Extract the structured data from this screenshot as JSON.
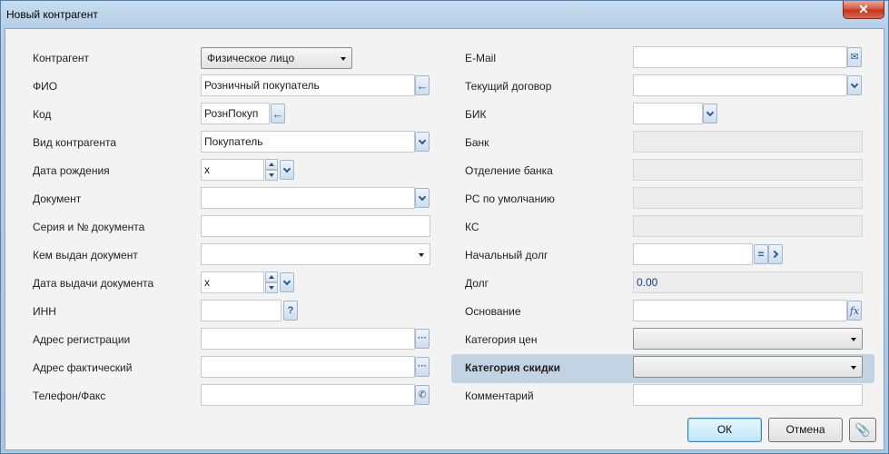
{
  "window": {
    "title": "Новый контрагент",
    "close_label": "✕"
  },
  "left": {
    "counterparty_label": "Контрагент",
    "counterparty_value": "Физическое лицо",
    "fio_label": "ФИО",
    "fio_value": "Розничный покупатель",
    "code_label": "Код",
    "code_value": "РознПокуп",
    "kind_label": "Вид контрагента",
    "kind_value": "Покупатель",
    "birth_label": "Дата рождения",
    "birth_value": "x",
    "doc_label": "Документ",
    "doc_value": "",
    "doc_series_label": "Серия и № документа",
    "doc_series_value": "",
    "issued_by_label": "Кем выдан документ",
    "issued_by_value": "",
    "issue_date_label": "Дата выдачи документа",
    "issue_date_value": "x",
    "inn_label": "ИНН",
    "inn_value": "",
    "reg_addr_label": "Адрес регистрации",
    "reg_addr_value": "",
    "fact_addr_label": "Адрес фактический",
    "fact_addr_value": "",
    "phone_label": "Телефон/Факс",
    "phone_value": ""
  },
  "right": {
    "email_label": "E-Mail",
    "email_value": "",
    "contract_label": "Текущий договор",
    "contract_value": "",
    "bik_label": "БИК",
    "bik_value": "",
    "bank_label": "Банк",
    "bank_value": "",
    "branch_label": "Отделение банка",
    "branch_value": "",
    "account_label": "РС по умолчанию",
    "account_value": "",
    "ks_label": "КС",
    "ks_value": "",
    "init_debt_label": "Начальный долг",
    "init_debt_value": "",
    "debt_label": "Долг",
    "debt_value": "0.00",
    "basis_label": "Основание",
    "basis_value": "",
    "price_cat_label": "Категория цен",
    "price_cat_value": "",
    "discount_cat_label": "Категория скидки",
    "discount_cat_value": "",
    "comment_label": "Комментарий",
    "comment_value": ""
  },
  "buttons": {
    "ok": "ОК",
    "cancel": "Отмена"
  },
  "colors": {
    "highlight": "#c4d3e4",
    "value_text": "#1e3c78",
    "close": "#c2311b"
  }
}
